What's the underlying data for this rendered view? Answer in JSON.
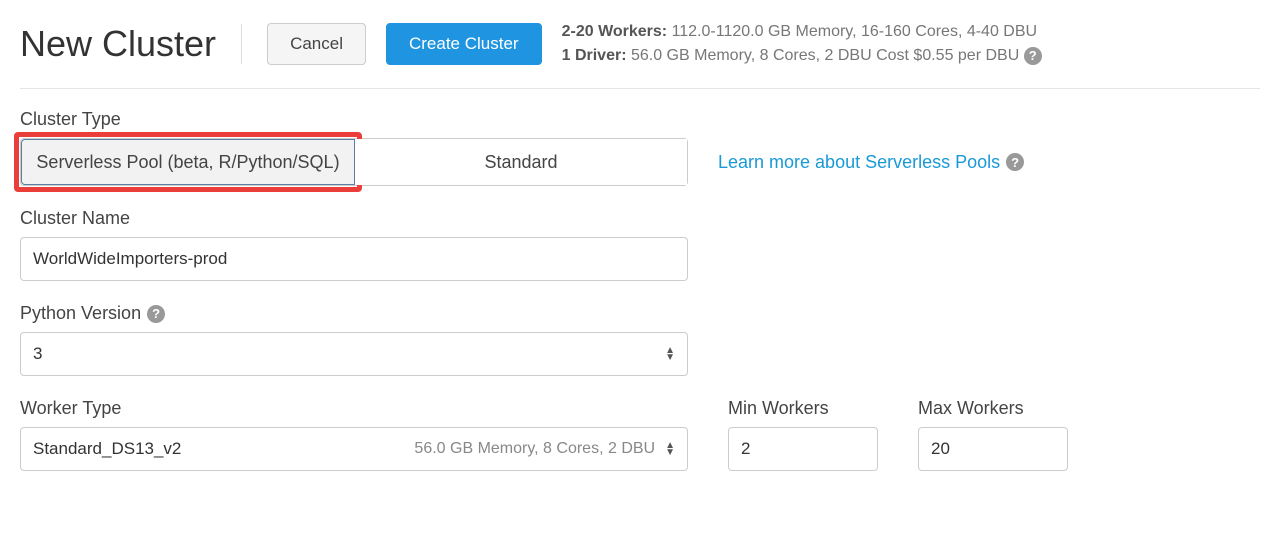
{
  "header": {
    "title": "New Cluster",
    "cancel_label": "Cancel",
    "create_label": "Create Cluster"
  },
  "summary": {
    "workers_label": "2-20 Workers:",
    "workers_text": " 112.0-1120.0 GB Memory, 16-160 Cores, 4-40 DBU",
    "driver_label": "1 Driver:",
    "driver_text": " 56.0 GB Memory, 8 Cores, 2 DBU Cost $0.55 per DBU "
  },
  "cluster_type": {
    "label": "Cluster Type",
    "option_serverless": "Serverless Pool (beta, R/Python/SQL)",
    "option_standard": "Standard",
    "learn_more": "Learn more about Serverless Pools"
  },
  "cluster_name": {
    "label": "Cluster Name",
    "value": "WorldWideImporters-prod"
  },
  "python_version": {
    "label": "Python Version",
    "value": "3"
  },
  "worker_type": {
    "label": "Worker Type",
    "value": "Standard_DS13_v2",
    "meta": "56.0 GB Memory, 8 Cores, 2 DBU"
  },
  "min_workers": {
    "label": "Min Workers",
    "value": "2"
  },
  "max_workers": {
    "label": "Max Workers",
    "value": "20"
  }
}
